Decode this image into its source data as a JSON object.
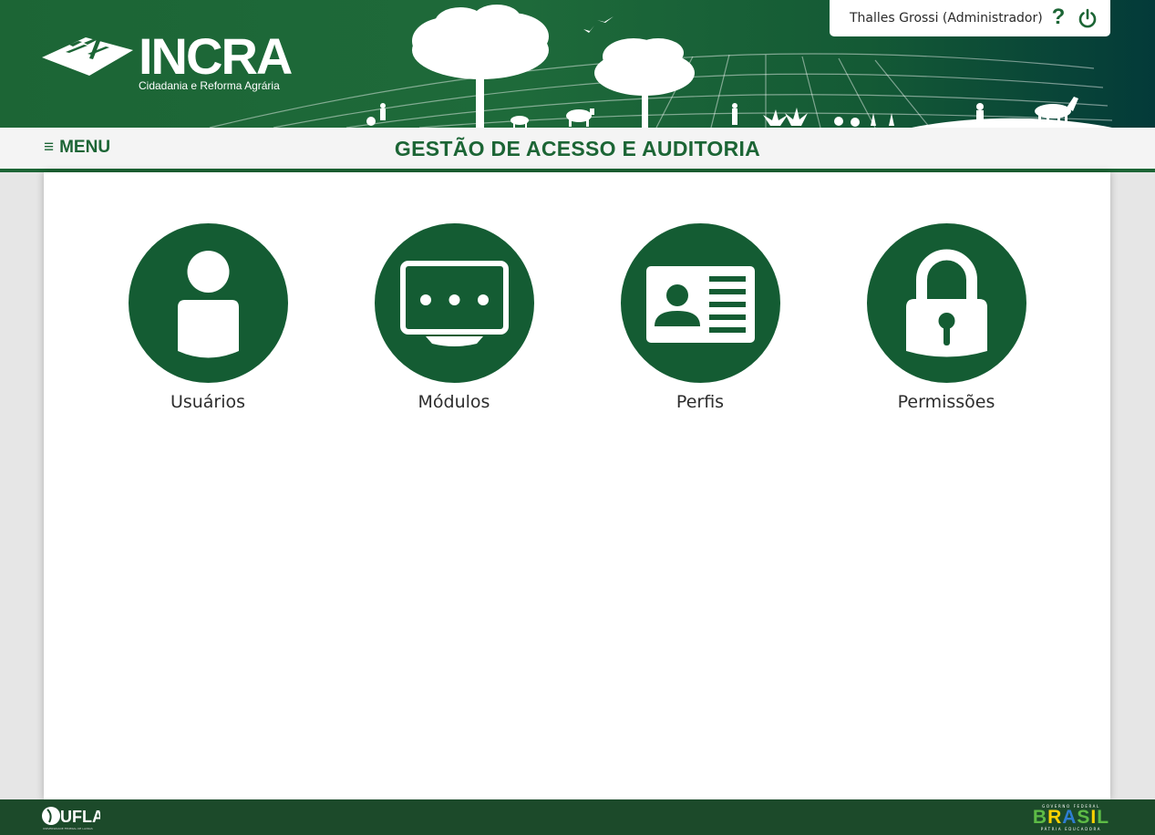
{
  "header": {
    "logo_word": "INCRA",
    "logo_subtitle": "Cidadania e Reforma Agrária",
    "user_label": "Thalles Grossi (Administrador)",
    "help_label": "?"
  },
  "navbar": {
    "menu_icon": "≡",
    "menu_label": "MENU",
    "page_title": "GESTÃO DE ACESSO E AUDITORIA"
  },
  "tiles": [
    {
      "label": "Usuários",
      "icon": "user-icon"
    },
    {
      "label": "Módulos",
      "icon": "monitor-icon"
    },
    {
      "label": "Perfis",
      "icon": "id-card-icon"
    },
    {
      "label": "Permissões",
      "icon": "lock-icon"
    }
  ],
  "footer": {
    "ufla_label": "UFLA",
    "ufla_subtitle": "UNIVERSIDADE FEDERAL DE LAVRAS",
    "gov_top": "GOVERNO FEDERAL",
    "gov_bottom": "PÁTRIA EDUCADORA",
    "gov_letters": [
      "B",
      "R",
      "A",
      "S",
      "I",
      "L"
    ]
  },
  "colors": {
    "brand_green": "#1c6535",
    "tile_green": "#145c33",
    "footer_green": "#1c4a2a",
    "panel_bg": "#ffffff",
    "page_bg": "#e6e6e6"
  }
}
